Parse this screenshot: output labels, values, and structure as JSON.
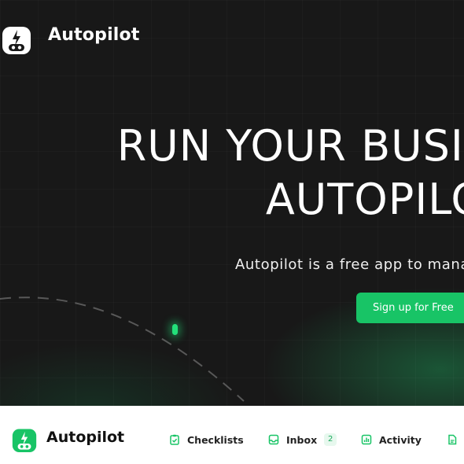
{
  "brand": {
    "name": "Autopilot",
    "accent": "#18c466",
    "logo_icon": "robot-bolt-icon"
  },
  "hero": {
    "headline_line1": "RUN YOUR BUSINESS ON",
    "headline_line2": "AUTOPILOT",
    "subtitle": "Autopilot is a free app to manage your business",
    "cta_label": "Sign up for Free"
  },
  "nav": {
    "items": [
      {
        "label": "Checklists",
        "icon": "clipboard-check-icon"
      },
      {
        "label": "Inbox",
        "icon": "inbox-icon",
        "badge": "2"
      },
      {
        "label": "Activity",
        "icon": "bar-chart-icon"
      },
      {
        "label": "",
        "icon": "document-icon"
      }
    ]
  }
}
